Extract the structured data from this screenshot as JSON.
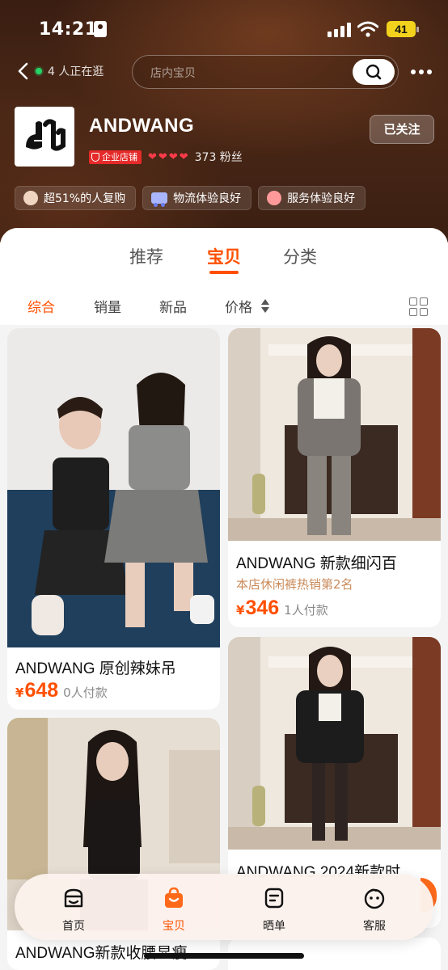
{
  "status_bar": {
    "time": "14:21",
    "battery": "41"
  },
  "nav": {
    "online_text": "4 人正在逛",
    "search_placeholder": "店内宝贝"
  },
  "shop": {
    "name": "ANDWANG",
    "badge": "企业店铺",
    "hearts": 4,
    "fans": "373 粉丝",
    "follow_label": "已关注",
    "chips": [
      "超51%的人复购",
      "物流体验良好",
      "服务体验良好"
    ]
  },
  "tabs": [
    {
      "label": "推荐",
      "active": false
    },
    {
      "label": "宝贝",
      "active": true
    },
    {
      "label": "分类",
      "active": false
    }
  ],
  "sorts": [
    {
      "label": "综合",
      "active": true
    },
    {
      "label": "销量",
      "active": false
    },
    {
      "label": "新品",
      "active": false
    },
    {
      "label": "价格",
      "active": false
    }
  ],
  "products": [
    {
      "title": "ANDWANG 原创辣妹吊",
      "subtitle": "",
      "price": "648",
      "paid": "0人付款",
      "currency": "¥"
    },
    {
      "title": "ANDWANG 新款细闪百",
      "subtitle": "本店休闲裤热销第2名",
      "price": "346",
      "paid": "1人付款",
      "currency": "¥"
    },
    {
      "title": "ANDWANG 2024新款时",
      "subtitle": "",
      "price": "",
      "paid": "",
      "currency": ""
    },
    {
      "title": "ANDWANG新款收腰显瘦",
      "subtitle": "",
      "price": "",
      "paid": "",
      "currency": ""
    }
  ],
  "tabbar": [
    {
      "label": "首页",
      "icon": "shop-icon",
      "active": false
    },
    {
      "label": "宝贝",
      "icon": "bag-icon",
      "active": true
    },
    {
      "label": "晒单",
      "icon": "review-icon",
      "active": false
    },
    {
      "label": "客服",
      "icon": "service-icon",
      "active": false
    }
  ],
  "colors": {
    "accent": "#ff5000",
    "header_bg": "#3b1f12"
  }
}
